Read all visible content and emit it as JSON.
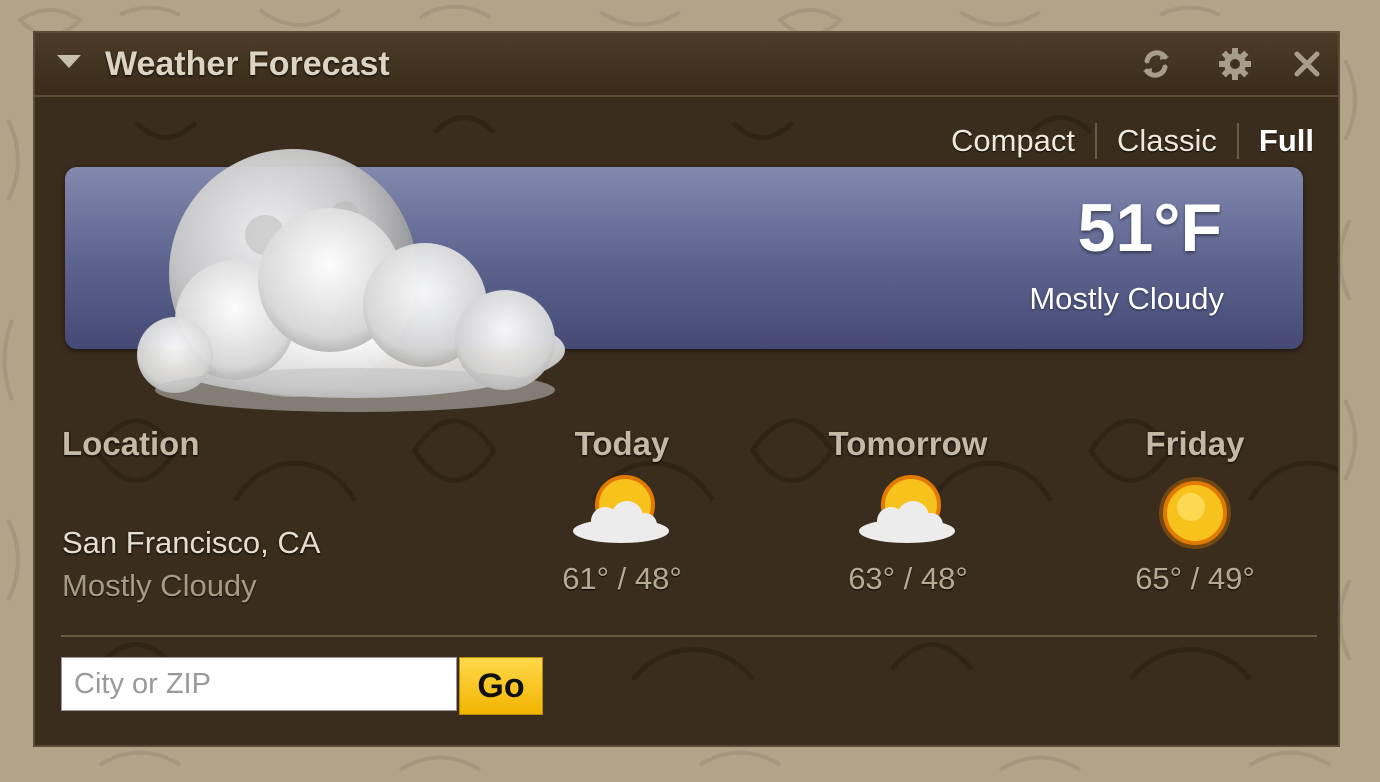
{
  "widget": {
    "title": "Weather Forecast"
  },
  "modes": [
    "Compact",
    "Classic",
    "Full"
  ],
  "active_mode": "Full",
  "current": {
    "temperature": "51°F",
    "condition": "Mostly Cloudy",
    "icon": "moon-cloud-icon"
  },
  "location": {
    "header": "Location",
    "name": "San Francisco, CA",
    "condition": "Mostly Cloudy"
  },
  "forecast": [
    {
      "day": "Today",
      "range": "61° / 48°",
      "icon": "partly-sunny-icon"
    },
    {
      "day": "Tomorrow",
      "range": "63° / 48°",
      "icon": "partly-sunny-icon"
    },
    {
      "day": "Friday",
      "range": "65° / 49°",
      "icon": "sunny-icon"
    }
  ],
  "search": {
    "placeholder": "City or ZIP",
    "value": "",
    "button_label": "Go"
  },
  "colors": {
    "panel_bg": "#3b2d1d",
    "banner_top": "#8289ad",
    "banner_bottom": "#444a75",
    "go_button": "#f2b500"
  }
}
